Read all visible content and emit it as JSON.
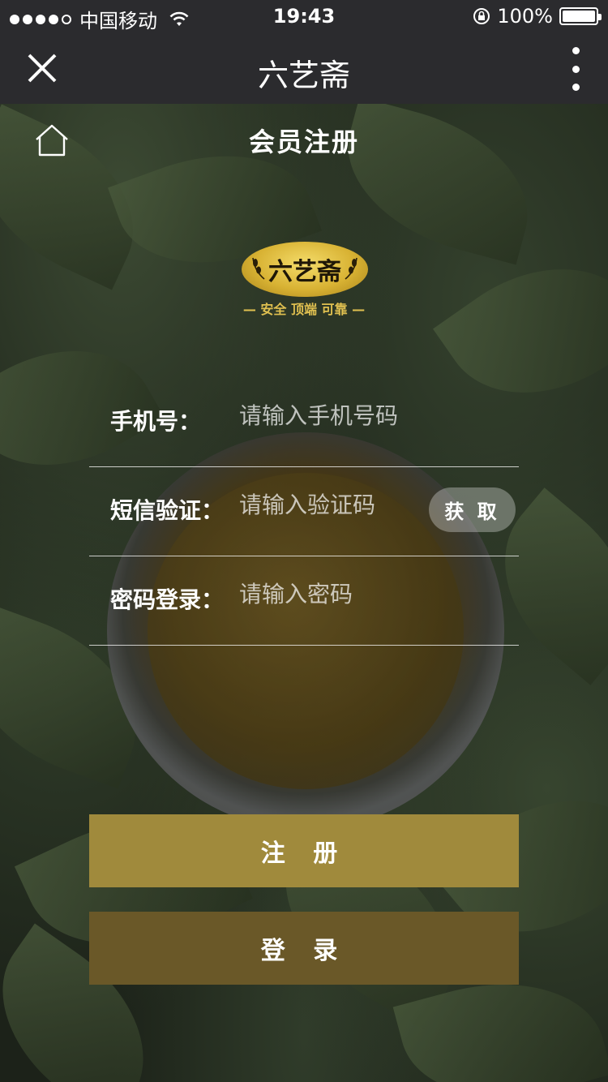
{
  "status_bar": {
    "carrier": "中国移动",
    "time": "19:43",
    "battery": "100%"
  },
  "nav": {
    "title": "六艺斋"
  },
  "page": {
    "title": "会员注册"
  },
  "logo": {
    "text": "六艺斋",
    "slogan": "— 安全 顶端 可靠 —"
  },
  "form": {
    "phone": {
      "label": "手机号：",
      "placeholder": "请输入手机号码"
    },
    "sms": {
      "label": "短信验证：",
      "placeholder": "请输入验证码",
      "button": "获 取"
    },
    "password": {
      "label": "密码登录：",
      "placeholder": "请输入密码"
    }
  },
  "buttons": {
    "register": "注 册",
    "login": "登 录"
  },
  "colors": {
    "nav_bg": "#2b2b2e",
    "register_bg": "#a08a3c",
    "login_bg": "#6a5828",
    "logo_gold": "#d8b233"
  }
}
